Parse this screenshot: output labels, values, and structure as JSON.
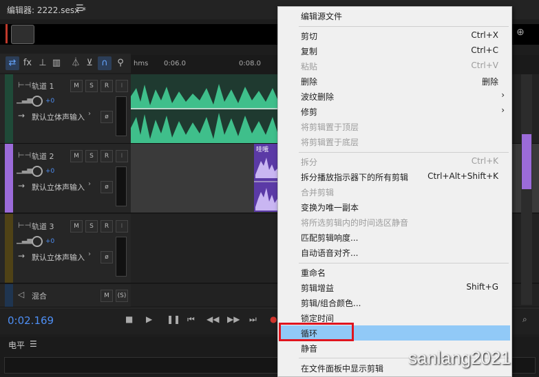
{
  "editor": {
    "title": "编辑器: 2222.sesx *",
    "menu_icon": "hamburger-icon"
  },
  "ruler": {
    "unit": "hms",
    "labels": [
      "0:06.0",
      "0:08.0"
    ]
  },
  "tracks": [
    {
      "name": "轨道 1",
      "volume": "+0",
      "input": "默认立体声输入",
      "color": "#2e6a4f",
      "m": "M",
      "s": "S",
      "r": "R",
      "i": "I"
    },
    {
      "name": "轨道 2",
      "volume": "+0",
      "input": "默认立体声输入",
      "color": "#9b6bd9",
      "m": "M",
      "s": "S",
      "r": "R",
      "i": "I"
    },
    {
      "name": "轨道 3",
      "volume": "+0",
      "input": "默认立体声输入",
      "color": "#6a5a1f",
      "m": "M",
      "s": "S",
      "r": "R",
      "i": "I"
    }
  ],
  "mix": {
    "name": "混合",
    "m": "M",
    "s": "(S)"
  },
  "clip2": {
    "label": "哇哦"
  },
  "transport": {
    "time": "0:02.169"
  },
  "levels": {
    "label": "电平"
  },
  "context_menu": {
    "items": [
      {
        "label": "编辑源文件",
        "shortcut": "",
        "disabled": false
      },
      {
        "label": "剪切",
        "shortcut": "Ctrl+X",
        "disabled": false
      },
      {
        "label": "复制",
        "shortcut": "Ctrl+C",
        "disabled": false
      },
      {
        "label": "粘贴",
        "shortcut": "Ctrl+V",
        "disabled": true
      },
      {
        "label": "删除",
        "shortcut": "删除",
        "disabled": false
      },
      {
        "label": "波纹删除",
        "shortcut": "",
        "disabled": false,
        "submenu": true
      },
      {
        "label": "修剪",
        "shortcut": "",
        "disabled": false,
        "submenu": true
      },
      {
        "label": "将剪辑置于顶层",
        "shortcut": "",
        "disabled": true
      },
      {
        "label": "将剪辑置于底层",
        "shortcut": "",
        "disabled": true
      },
      {
        "label": "拆分",
        "shortcut": "Ctrl+K",
        "disabled": true
      },
      {
        "label": "拆分播放指示器下的所有剪辑",
        "shortcut": "Ctrl+Alt+Shift+K",
        "disabled": false
      },
      {
        "label": "合并剪辑",
        "shortcut": "",
        "disabled": true
      },
      {
        "label": "变换为唯一副本",
        "shortcut": "",
        "disabled": false
      },
      {
        "label": "将所选剪辑内的时间选区静音",
        "shortcut": "",
        "disabled": true
      },
      {
        "label": "匹配剪辑响度...",
        "shortcut": "",
        "disabled": false
      },
      {
        "label": "自动语音对齐...",
        "shortcut": "",
        "disabled": false
      },
      {
        "label": "重命名",
        "shortcut": "",
        "disabled": false
      },
      {
        "label": "剪辑增益",
        "shortcut": "Shift+G",
        "disabled": false
      },
      {
        "label": "剪辑/组合颜色...",
        "shortcut": "",
        "disabled": false
      },
      {
        "label": "锁定时间",
        "shortcut": "",
        "disabled": false
      },
      {
        "label": "循环",
        "shortcut": "",
        "disabled": false,
        "highlighted": true
      },
      {
        "label": "静音",
        "shortcut": "",
        "disabled": false
      },
      {
        "label": "在文件面板中显示剪辑",
        "shortcut": "",
        "disabled": false
      }
    ]
  },
  "watermark": "sanlang2021"
}
